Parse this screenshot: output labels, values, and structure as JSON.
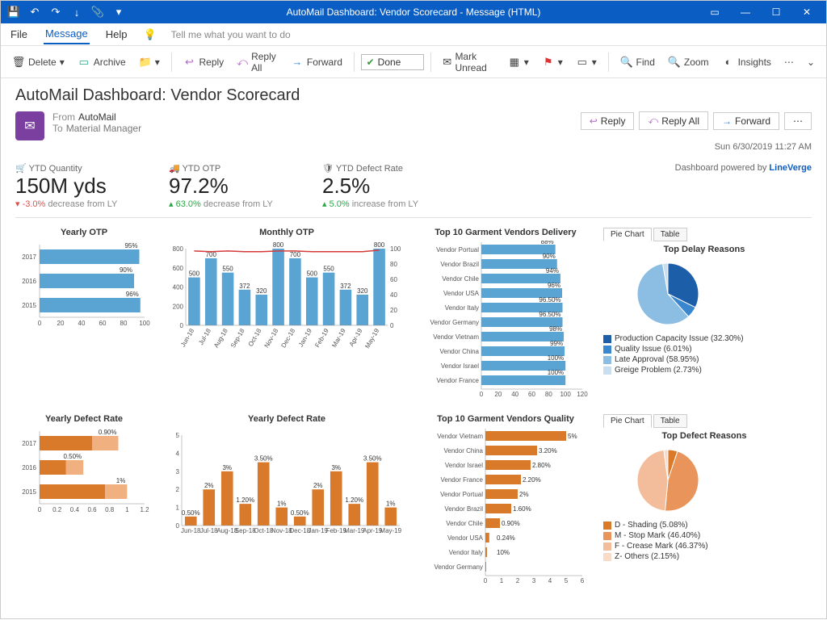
{
  "window": {
    "title": "AutoMail Dashboard: Vendor Scorecard  -  Message (HTML)"
  },
  "menu": {
    "file": "File",
    "message": "Message",
    "help": "Help",
    "tellme": "Tell me what you want to do"
  },
  "ribbon": {
    "delete": "Delete",
    "archive": "Archive",
    "reply": "Reply",
    "replyall": "Reply All",
    "forward": "Forward",
    "done": "Done",
    "markunread": "Mark Unread",
    "find": "Find",
    "zoom": "Zoom",
    "insights": "Insights"
  },
  "message": {
    "subject": "AutoMail Dashboard: Vendor Scorecard",
    "from_label": "From",
    "from": "AutoMail",
    "to_label": "To",
    "to": "Material Manager",
    "datetime": "Sun 6/30/2019 11:27 AM",
    "reply": "Reply",
    "replyall": "Reply All",
    "forward": "Forward"
  },
  "kpi": {
    "qty_label": "YTD Quantity",
    "qty_val": "150M yds",
    "qty_delta_pct": "-3.0%",
    "qty_delta_txt": "decrease from LY",
    "otp_label": "YTD OTP",
    "otp_val": "97.2%",
    "otp_delta_pct": "63.0%",
    "otp_delta_txt": "decrease from LY",
    "def_label": "YTD Defect Rate",
    "def_val": "2.5%",
    "def_delta_pct": "5.0%",
    "def_delta_txt": "increase from LY",
    "powered_pre": "Dashboard powered by ",
    "powered": "LineVerge"
  },
  "tabs": {
    "pie": "Pie Chart",
    "table": "Table"
  },
  "chart_data": [
    {
      "id": "yearly_otp",
      "type": "bar",
      "orientation": "horizontal",
      "title": "Yearly OTP",
      "categories": [
        "2017",
        "2016",
        "2015"
      ],
      "values": [
        95,
        90,
        96
      ],
      "value_labels": [
        "95%",
        "90%",
        "96%"
      ],
      "xlim": [
        0,
        100
      ],
      "xticks": [
        0,
        20,
        40,
        60,
        80,
        100
      ]
    },
    {
      "id": "monthly_otp",
      "type": "bar+line",
      "title": "Monthly OTP",
      "categories": [
        "Jun-18",
        "Jul-18",
        "Aug-18",
        "Sep-18",
        "Oct-18",
        "Nov-18",
        "Dec-18",
        "Jan-19",
        "Feb-19",
        "Mar-19",
        "Apr-19",
        "May-19"
      ],
      "series": [
        {
          "name": "Bars",
          "axis": "left",
          "values": [
            500,
            700,
            550,
            372,
            320,
            800,
            700,
            500,
            550,
            372,
            320,
            800
          ]
        },
        {
          "name": "Line",
          "axis": "right",
          "values": [
            97,
            96,
            97,
            96,
            96,
            97,
            97,
            96,
            96,
            96,
            96,
            98
          ]
        }
      ],
      "bar_labels": [
        "500",
        "700",
        "550",
        "372",
        "320",
        "800",
        "700",
        "500",
        "550",
        "372",
        "320",
        "800"
      ],
      "ylim_left": [
        0,
        800
      ],
      "yticks_left": [
        0,
        200,
        400,
        600,
        800
      ],
      "ylim_right": [
        0,
        100
      ],
      "yticks_right": [
        0,
        20,
        40,
        60,
        80,
        100
      ]
    },
    {
      "id": "top_vendors_delivery",
      "type": "bar",
      "orientation": "horizontal",
      "title": "Top 10 Garment Vendors Delivery",
      "categories": [
        "Vendor Portual",
        "Vendor Brazil",
        "Vendor Chile",
        "Vendor USA",
        "Vendor Italy",
        "Vendor Germany",
        "Vendor Vietnam",
        "Vendor China",
        "Vendor Israel",
        "Vendor France"
      ],
      "values": [
        88,
        90,
        94,
        96,
        96.5,
        96.5,
        98,
        99,
        100,
        100
      ],
      "value_labels": [
        "88%",
        "90%",
        "94%",
        "96%",
        "96.50%",
        "96.50%",
        "98%",
        "99%",
        "100%",
        "100%"
      ],
      "xlim": [
        0,
        120
      ],
      "xticks": [
        0,
        20,
        40,
        60,
        80,
        100,
        120
      ]
    },
    {
      "id": "top_delay_reasons",
      "type": "pie",
      "title": "Top Delay Reasons",
      "slices": [
        {
          "label": "Production Capacity Issue",
          "pct": 32.3,
          "color": "#1c5ea8"
        },
        {
          "label": "Quality Issue",
          "pct": 6.01,
          "color": "#3a87cf"
        },
        {
          "label": "Late Approval",
          "pct": 58.95,
          "color": "#8cbde2"
        },
        {
          "label": "Greige Problem",
          "pct": 2.73,
          "color": "#c9deee"
        }
      ]
    },
    {
      "id": "yearly_defect",
      "type": "stacked-bar",
      "orientation": "horizontal",
      "title": "Yearly Defect Rate",
      "categories": [
        "2017",
        "2016",
        "2015"
      ],
      "series": [
        {
          "name": "dark",
          "values": [
            0.6,
            0.3,
            0.75
          ],
          "color": "#d97a2b"
        },
        {
          "name": "light",
          "values": [
            0.3,
            0.2,
            0.25
          ],
          "color": "#f0b080"
        }
      ],
      "value_labels": [
        "0.90%",
        "0.50%",
        "1%"
      ],
      "xlim": [
        0,
        1.2
      ],
      "xticks": [
        0,
        0.2,
        0.4,
        0.6,
        0.8,
        1,
        1.2
      ]
    },
    {
      "id": "monthly_defect",
      "type": "bar",
      "title": "Yearly Defect Rate",
      "categories": [
        "Jun-18",
        "Jul-18",
        "Aug-18",
        "Sep-18",
        "Oct-18",
        "Nov-18",
        "Dec-18",
        "Jan-19",
        "Feb-19",
        "Mar-19",
        "Apr-19",
        "May-19"
      ],
      "values": [
        0.5,
        2,
        3,
        1.2,
        3.5,
        1,
        0.5,
        2,
        3,
        1.2,
        3.5,
        1
      ],
      "value_labels": [
        "0.50%",
        "2%",
        "3%",
        "1.20%",
        "3.50%",
        "1%",
        "0.50%",
        "2%",
        "3%",
        "1.20%",
        "3.50%",
        "1%"
      ],
      "ylim": [
        0,
        5
      ],
      "yticks": [
        0,
        1,
        2,
        3,
        4,
        5
      ]
    },
    {
      "id": "top_vendors_quality",
      "type": "bar",
      "orientation": "horizontal",
      "title": "Top 10 Garment Vendors Quality",
      "categories": [
        "Vendor Vietnam",
        "Vendor China",
        "Vendor Israel",
        "Vendor France",
        "Vendor Portual",
        "Vendor Brazil",
        "Vendor Chile",
        "Vendor USA",
        "Vendor Italy",
        "Vendor Germany"
      ],
      "values": [
        5,
        3.2,
        2.8,
        2.2,
        2,
        1.6,
        0.9,
        0.24,
        0.1,
        0
      ],
      "value_labels": [
        "5%",
        "3.20%",
        "2.80%",
        "2.20%",
        "2%",
        "1.60%",
        "0.90%",
        "0.24%",
        "10%",
        ""
      ],
      "xlim": [
        0,
        6
      ],
      "xticks": [
        0,
        1,
        2,
        3,
        4,
        5,
        6
      ]
    },
    {
      "id": "top_defect_reasons",
      "type": "pie",
      "title": "Top Defect Reasons",
      "slices": [
        {
          "label": "D - Shading",
          "pct": 5.08,
          "color": "#d97a2b"
        },
        {
          "label": "M - Stop Mark",
          "pct": 46.4,
          "color": "#e8945a"
        },
        {
          "label": "F - Crease Mark",
          "pct": 46.37,
          "color": "#f3bd9c"
        },
        {
          "label": "Z- Others",
          "pct": 2.15,
          "color": "#f8dcc8"
        }
      ]
    }
  ]
}
